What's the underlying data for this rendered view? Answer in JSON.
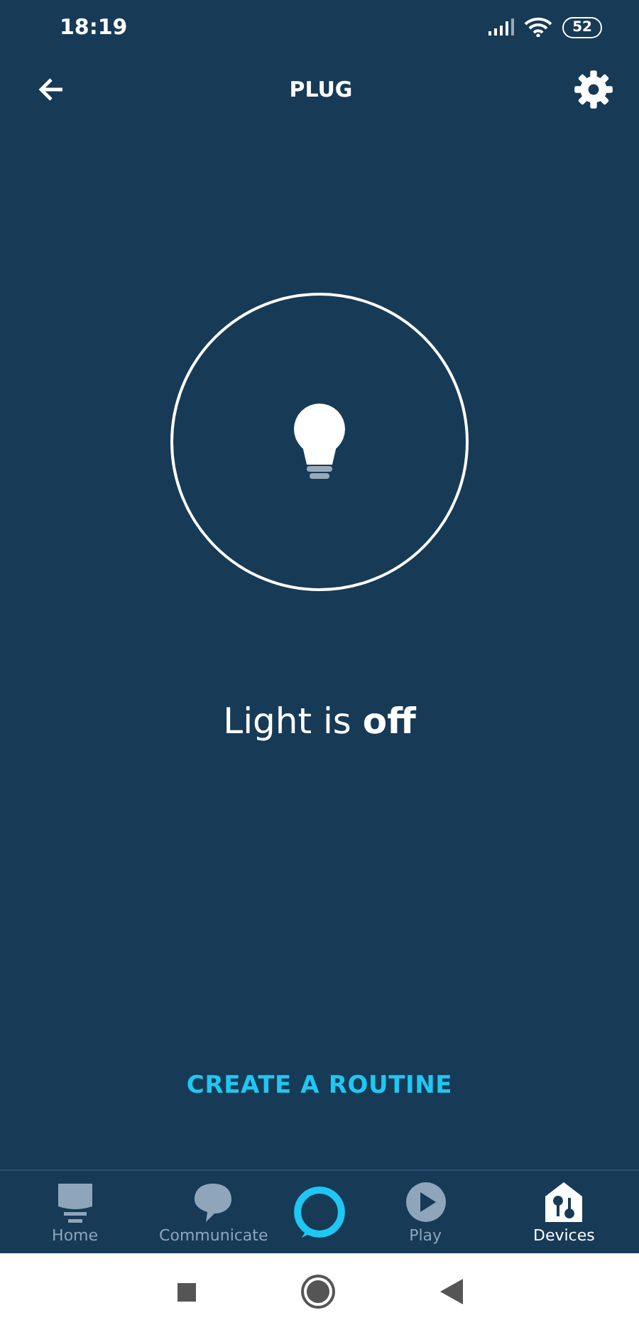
{
  "status_bar": {
    "time": "18:19",
    "battery": "52"
  },
  "header": {
    "title": "PLUG"
  },
  "device": {
    "status": "Light is **off**",
    "on": false
  },
  "action": {
    "label": "CREATE A ROUTINE"
  },
  "nav": [
    {
      "kind": "home",
      "label": "Home",
      "selected": false
    },
    {
      "kind": "chat",
      "label": "Communicate",
      "selected": false
    },
    {
      "kind": "alexa",
      "selected": false
    },
    {
      "kind": "play",
      "label": "Play",
      "selected": false
    },
    {
      "kind": "devices",
      "label": "Devices",
      "selected": true
    }
  ]
}
